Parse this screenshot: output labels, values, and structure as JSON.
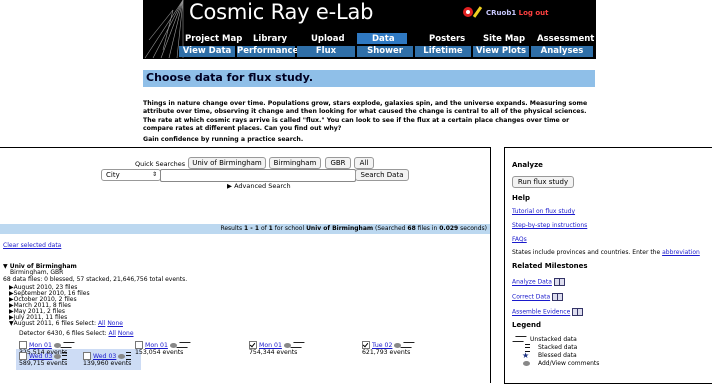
{
  "header": {
    "title": "Cosmic Ray e-Lab",
    "user": "CRuob1",
    "logout": "Log out",
    "nav_top": [
      "Project Map",
      "Library",
      "Upload",
      "Data",
      "Posters",
      "Site Map",
      "Assessment"
    ],
    "nav_sub": [
      "View Data",
      "Performance",
      "Flux",
      "Shower",
      "Lifetime",
      "View Plots",
      "Analyses"
    ],
    "active_color": "#2f79c2"
  },
  "page": {
    "heading": "Choose data for flux study.",
    "intro": "Things in nature change over time. Populations grow, stars explode, galaxies spin, and the universe expands. Measuring some attribute over time, observing it change and then looking for what caused the change is central to all of the physical sciences. The rate at which cosmic rays arrive is called \"flux.\" You can look to see if the flux at a certain place changes over time or compare rates at different places. Can you find out why?",
    "confidence": "Gain confidence by running a practice search."
  },
  "search": {
    "quick_label": "Quick Searches",
    "quick_buttons": [
      "Univ of Birmingham",
      "Birmingham",
      "GBR",
      "All"
    ],
    "field_select": "City",
    "input_value": "",
    "search_button": "Search Data",
    "advanced": "▶ Advanced Search"
  },
  "results": {
    "prefix": "Results ",
    "range": "1 - 1",
    "of": " of ",
    "total": "1",
    "for_school": " for school ",
    "school": "Univ of Birmingham",
    "searched": " (Searched ",
    "files": "68",
    "files_in": " files in ",
    "seconds": "0.029",
    "seconds_suffix": " seconds)"
  },
  "tree": {
    "clear": "Clear selected data",
    "school": "▼ Univ of Birmingham",
    "location": "Birmingham, GBR",
    "summary": "68 data files: 0 blessed, 57 stacked, 21,646,756 total events.",
    "months": [
      "▶August 2010, 23 files",
      "▶September 2010, 16 files",
      "▶October 2010, 2 files",
      "▶March 2011, 8 files",
      "▶May 2011, 2 files",
      "▶July 2011, 11 files"
    ],
    "open_month": "▼August 2011, 6 files Select: ",
    "all": "All",
    "none": "None",
    "detector": "Detector 6430, 6 files Select: ",
    "files": [
      {
        "day": "Mon 01",
        "events": "325,514 events",
        "checked": false,
        "icon": "unstacked"
      },
      {
        "day": "Mon 01",
        "events": "153,054 events",
        "checked": false,
        "icon": "unstacked"
      },
      {
        "day": "Mon 01",
        "events": "754,344 events",
        "checked": true,
        "icon": "unstacked"
      },
      {
        "day": "Tue 02",
        "events": "621,793 events",
        "checked": true,
        "icon": "unstacked"
      },
      {
        "day": "Wed 03",
        "events": "589,715 events",
        "checked": false,
        "icon": "stacked"
      },
      {
        "day": "Wed 03",
        "events": "139,960 events",
        "checked": false,
        "icon": "stacked"
      }
    ]
  },
  "sidebar": {
    "analyze_heading": "Analyze",
    "run_button": "Run flux study",
    "help_heading": "Help",
    "tutorial": "Tutorial on flux study",
    "instructions": "Step-by-step instructions",
    "faqs": "FAQs",
    "states_text": "States include provinces and countries. Enter the ",
    "abbreviation": "abbreviation",
    "milestones_heading": "Related Milestones",
    "milestones": [
      "Analyze Data",
      "Correct Data",
      "Assemble Evidence"
    ],
    "legend_heading": "Legend",
    "legend": [
      "Unstacked data",
      "Stacked data",
      "Blessed data",
      "Add/View comments"
    ]
  }
}
